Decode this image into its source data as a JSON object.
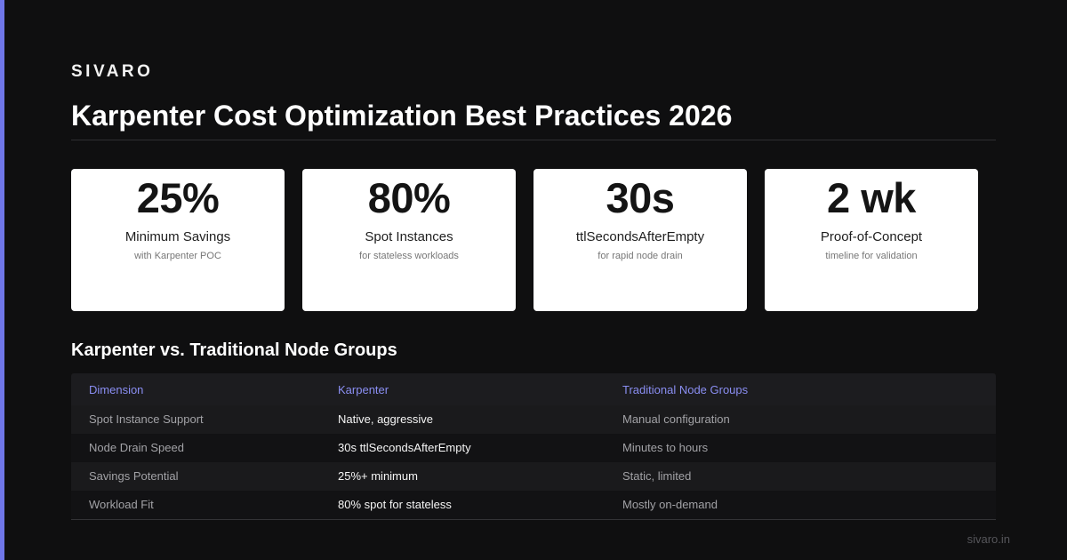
{
  "brand": "SIVARO",
  "title": "Karpenter Cost Optimization Best Practices 2026",
  "colors": {
    "accent": "#6f76e8",
    "background": "#0f0f10",
    "card": "#ffffff",
    "header_text": "#8a8ef2"
  },
  "stats": [
    {
      "value": "25%",
      "label": "Minimum Savings",
      "sub": "with Karpenter POC"
    },
    {
      "value": "80%",
      "label": "Spot Instances",
      "sub": "for stateless workloads"
    },
    {
      "value": "30s",
      "label": "ttlSecondsAfterEmpty",
      "sub": "for rapid node drain"
    },
    {
      "value": "2 wk",
      "label": "Proof-of-Concept",
      "sub": "timeline for validation"
    }
  ],
  "comparison": {
    "title": "Karpenter vs. Traditional Node Groups",
    "headers": [
      "Dimension",
      "Karpenter",
      "Traditional Node Groups"
    ],
    "rows": [
      [
        "Spot Instance Support",
        "Native, aggressive",
        "Manual configuration"
      ],
      [
        "Node Drain Speed",
        "30s ttlSecondsAfterEmpty",
        "Minutes to hours"
      ],
      [
        "Savings Potential",
        "25%+ minimum",
        "Static, limited"
      ],
      [
        "Workload Fit",
        "80% spot for stateless",
        "Mostly on-demand"
      ]
    ]
  },
  "footer": "sivaro.in"
}
